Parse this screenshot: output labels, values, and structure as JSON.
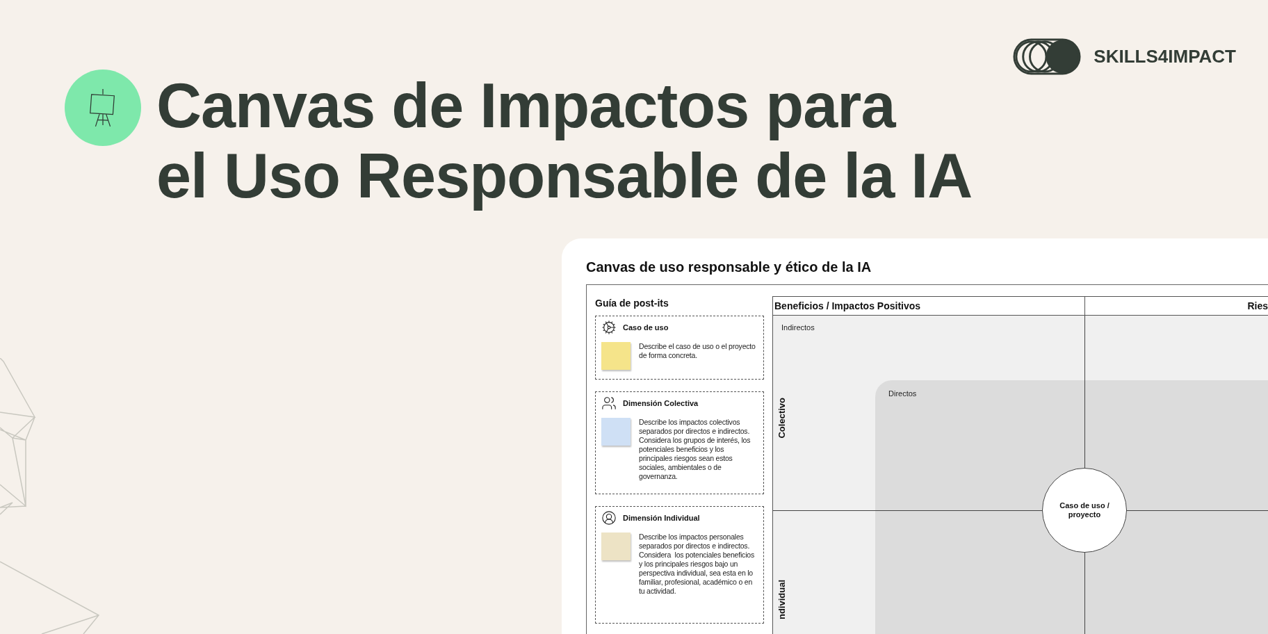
{
  "brand": {
    "name": "SKILLS4IMPACT"
  },
  "headline": {
    "lines": [
      "Canvas de Impactos para",
      "el Uso Responsable de la IA"
    ]
  },
  "document": {
    "title": "Canvas de uso responsable y ético de la IA",
    "guide": {
      "title": "Guía de post-its",
      "items": [
        {
          "kind": "usecase",
          "title": "Caso de uso",
          "color": "#f5e48a",
          "description": "Describe el caso de uso o el proyecto de forma concreta."
        },
        {
          "kind": "group",
          "title": "Dimensión Colectiva",
          "color": "#cfe0f5",
          "description": "Describe los impactos colectivos separados por directos e indirectos. Considera los grupos de interés, los potenciales beneficios y los principales riesgos sean estos sociales, ambientales o de governanza."
        },
        {
          "kind": "person",
          "title": "Dimensión Individual",
          "color": "#ede3c5",
          "description": "Describe los impactos personales separados por directos e indirectos. Considera  los potenciales beneficios y los principales riesgos bajo un perspectiva individual, sea esta en lo familiar, profesional, académico o en tu actividad."
        }
      ]
    },
    "columns": [
      "Beneficios / Impactos Positivos",
      "Ries"
    ],
    "rows": [
      "Colectivo",
      "ndividual"
    ],
    "zones": {
      "outer": "Indirectos",
      "inner": "Directos"
    },
    "center": "Caso de uso / proyecto"
  }
}
